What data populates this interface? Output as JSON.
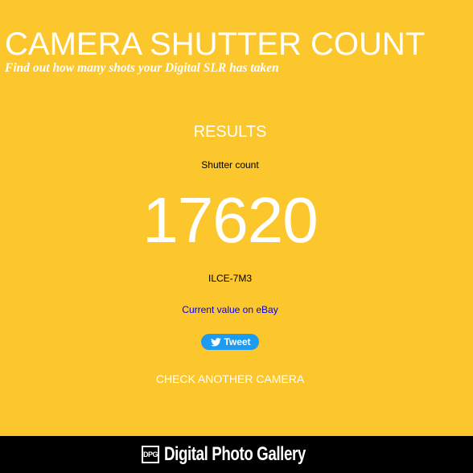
{
  "header": {
    "title": "CAMERA SHUTTER COUNT",
    "subtitle": "Find out how many shots your Digital SLR has taken"
  },
  "results": {
    "heading": "RESULTS",
    "count_label": "Shutter count",
    "count_value": "17620",
    "camera_model": "ILCE-7M3",
    "ebay_link": "Current value on eBay",
    "tweet_label": "Tweet",
    "check_another": "CHECK ANOTHER CAMERA"
  },
  "footer": {
    "logo_mark": "DPG",
    "brand_name": "Digital Photo Gallery"
  },
  "colors": {
    "background": "#fcc62d",
    "footer_background": "#000000",
    "link": "#0000ee",
    "tweet_button": "#1d9bf0"
  },
  "icons": {
    "tweet": "twitter-bird-icon",
    "logo": "dpg-logo-icon"
  }
}
